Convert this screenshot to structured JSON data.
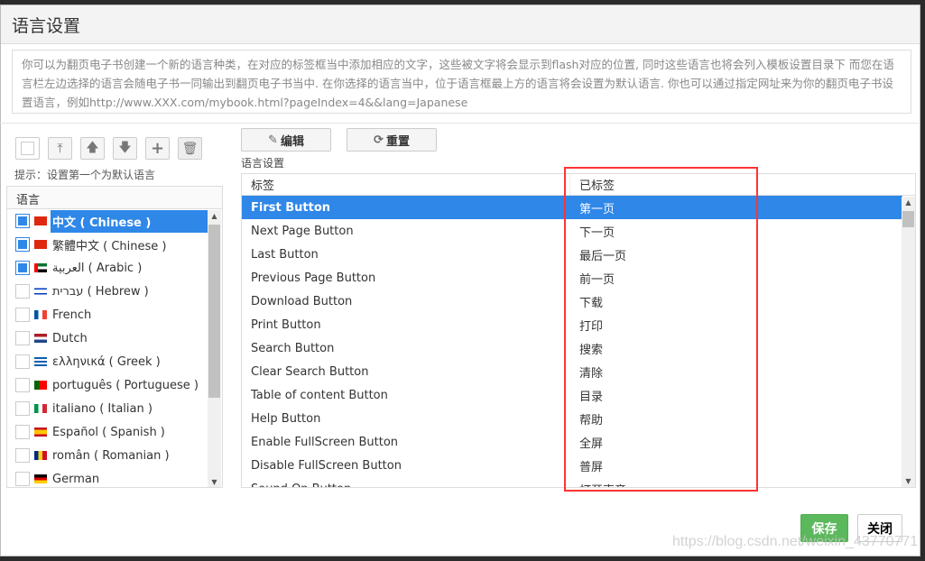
{
  "title": "语言设置",
  "description": "你可以为翻页电子书创建一个新的语言种类，在对应的标签框当中添加相应的文字，这些被文字将会显示到flash对应的位置, 同时这些语言也将会列入模板设置目录下 而您在语言栏左边选择的语言会随电子书一同输出到翻页电子书当中. 在你选择的语言当中，位于语言框最上方的语言将会设置为默认语言. 你也可以通过指定网址来为你的翻页电子书设置语言，例如http://www.XXX.com/mybook.html?pageIndex=4&&lang=Japanese",
  "toolbar": {
    "icons": [
      "select-all-checkbox",
      "move-top-icon",
      "move-up-icon",
      "move-down-icon",
      "add-icon",
      "delete-icon"
    ]
  },
  "hint": "提示：设置第一个为默认语言",
  "language_list": {
    "header": "语言",
    "items": [
      {
        "label": "中文 ( Chinese )",
        "checked": true,
        "selected": true,
        "flag": "cn"
      },
      {
        "label": "繁體中文 ( Chinese )",
        "checked": true,
        "flag": "cn"
      },
      {
        "label": "العربية ( Arabic )",
        "checked": true,
        "flag": "ae"
      },
      {
        "label": "עברית ( Hebrew )",
        "checked": false,
        "flag": "il"
      },
      {
        "label": "French",
        "checked": false,
        "flag": "fr"
      },
      {
        "label": "Dutch",
        "checked": false,
        "flag": "nl"
      },
      {
        "label": "ελληνικά ( Greek )",
        "checked": false,
        "flag": "gr"
      },
      {
        "label": "português ( Portuguese )",
        "checked": false,
        "flag": "pt"
      },
      {
        "label": "italiano ( Italian )",
        "checked": false,
        "flag": "it"
      },
      {
        "label": "Español ( Spanish )",
        "checked": false,
        "flag": "es"
      },
      {
        "label": "român ( Romanian )",
        "checked": false,
        "flag": "ro"
      },
      {
        "label": "German",
        "checked": false,
        "flag": "de"
      }
    ]
  },
  "buttons": {
    "edit": "编辑",
    "reset": "重置",
    "save": "保存",
    "close": "关闭"
  },
  "settings_label": "语言设置",
  "table": {
    "headers": [
      "标签",
      "已标签"
    ],
    "rows": [
      [
        "First Button",
        "第一页"
      ],
      [
        "Next Page Button",
        "下一页"
      ],
      [
        "Last Button",
        "最后一页"
      ],
      [
        "Previous Page Button",
        "前一页"
      ],
      [
        "Download Button",
        "下载"
      ],
      [
        "Print Button",
        "打印"
      ],
      [
        "Search Button",
        "搜索"
      ],
      [
        "Clear Search Button",
        "清除"
      ],
      [
        "Table of content Button",
        "目录"
      ],
      [
        "Help Button",
        "帮助"
      ],
      [
        "Enable FullScreen Button",
        "全屏"
      ],
      [
        "Disable FullScreen Button",
        "普屏"
      ],
      [
        "Sound On Button",
        "打开声音"
      ]
    ]
  },
  "watermark": "https://blog.csdn.net/weixin_43770771",
  "colors": {
    "accent": "#2f87e8",
    "save": "#5cb85c",
    "highlight_box": "#ff3333"
  }
}
